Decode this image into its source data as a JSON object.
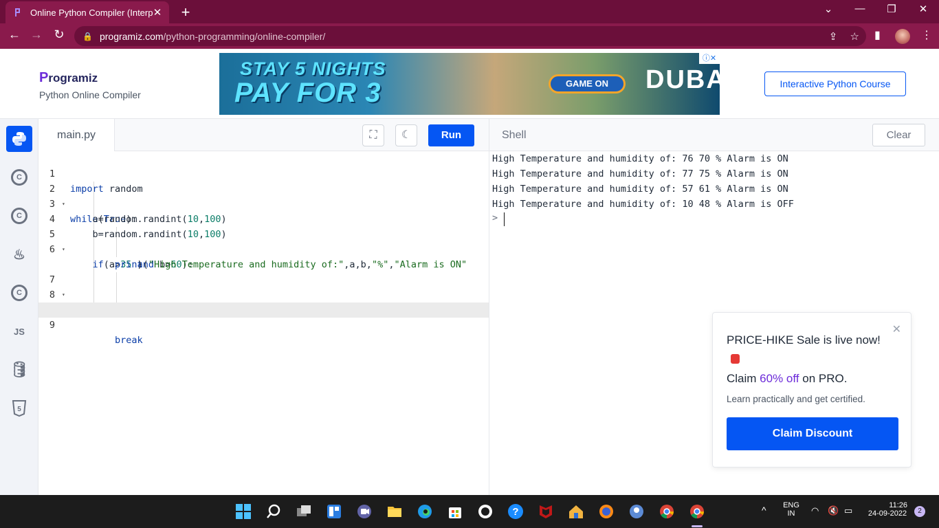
{
  "browser": {
    "tab_title": "Online Python Compiler (Interpre",
    "url_host": "programiz.com",
    "url_path": "/python-programming/online-compiler/"
  },
  "header": {
    "logo_text": "rogramiz",
    "logo_p": "P",
    "subtitle": "Python Online Compiler",
    "ad": {
      "line1": "STAY 5 NIGHTS",
      "line2": "PAY FOR 3",
      "cta": "GAME ON",
      "brand": "DUBAI"
    },
    "course_button": "Interactive Python Course"
  },
  "sidebar": {
    "items": [
      {
        "name": "python",
        "glyph": "🐍"
      },
      {
        "name": "c",
        "glyph": "C"
      },
      {
        "name": "cpp",
        "glyph": "C"
      },
      {
        "name": "java",
        "glyph": "♨"
      },
      {
        "name": "csharp",
        "glyph": "C"
      },
      {
        "name": "js",
        "glyph": "JS"
      },
      {
        "name": "sql",
        "glyph": "≡"
      },
      {
        "name": "html",
        "glyph": "5"
      }
    ]
  },
  "editor": {
    "filename": "main.py",
    "run_label": "Run",
    "line_numbers": [
      "1",
      "2",
      "3",
      "4",
      "5",
      "6",
      "",
      "7",
      "8",
      "",
      "9"
    ]
  },
  "shell": {
    "title": "Shell",
    "clear_label": "Clear",
    "output": [
      "High Temperature and humidity of: 76 70 % Alarm is ON",
      "High Temperature and humidity of: 77 75 % Alarm is ON",
      "High Temperature and humidity of: 57 61 % Alarm is ON",
      "High Temperature and humidity of: 10 48 % Alarm is OFF"
    ],
    "prompt": ">"
  },
  "promo": {
    "line1": "PRICE-HIKE Sale is live now!",
    "claim_prefix": "Claim ",
    "claim_highlight": "60% off",
    "claim_suffix": " on PRO.",
    "sub": "Learn practically and get certified.",
    "button": "Claim Discount"
  },
  "taskbar": {
    "lang": "ENG",
    "region": "IN",
    "time": "11:26",
    "date": "24-09-2022",
    "notifications": "2"
  },
  "colors": {
    "accent": "#0556f3",
    "brand_purple": "#6c2bd9",
    "browser_frame": "#8a1a4c"
  }
}
